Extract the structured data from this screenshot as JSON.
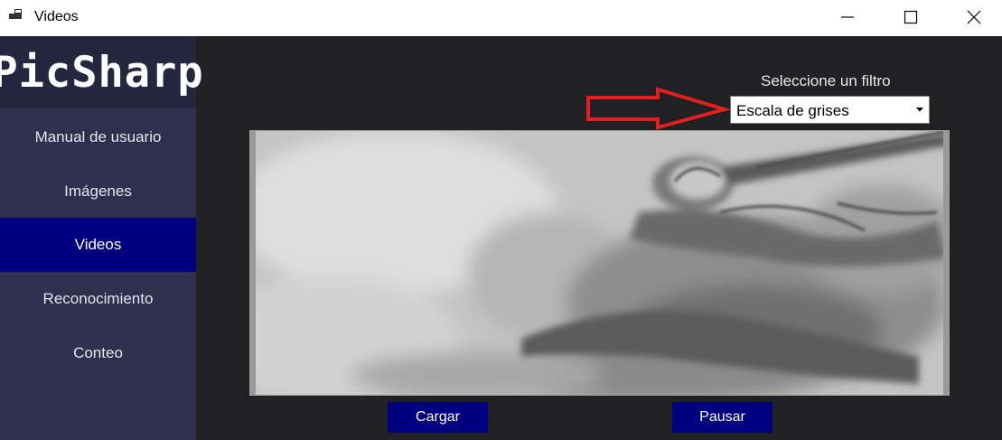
{
  "window": {
    "title": "Videos",
    "icon": "app-icon",
    "controls": [
      "minimize-icon",
      "maximize-icon",
      "close-icon"
    ]
  },
  "sidebar": {
    "logo": "PicSharp",
    "items": [
      {
        "label": "Manual de usuario",
        "active": false
      },
      {
        "label": "Imágenes",
        "active": false
      },
      {
        "label": "Videos",
        "active": true
      },
      {
        "label": "Reconocimiento",
        "active": false
      },
      {
        "label": "Conteo",
        "active": false
      }
    ]
  },
  "filter": {
    "label": "Seleccione un filtro",
    "selected": "Escala de grises"
  },
  "buttons": {
    "load": "Cargar",
    "pause": "Pausar"
  },
  "colors": {
    "sidebar": "#2f2f4e",
    "active": "#000080",
    "background": "#212124",
    "annotation": "#e02020"
  }
}
